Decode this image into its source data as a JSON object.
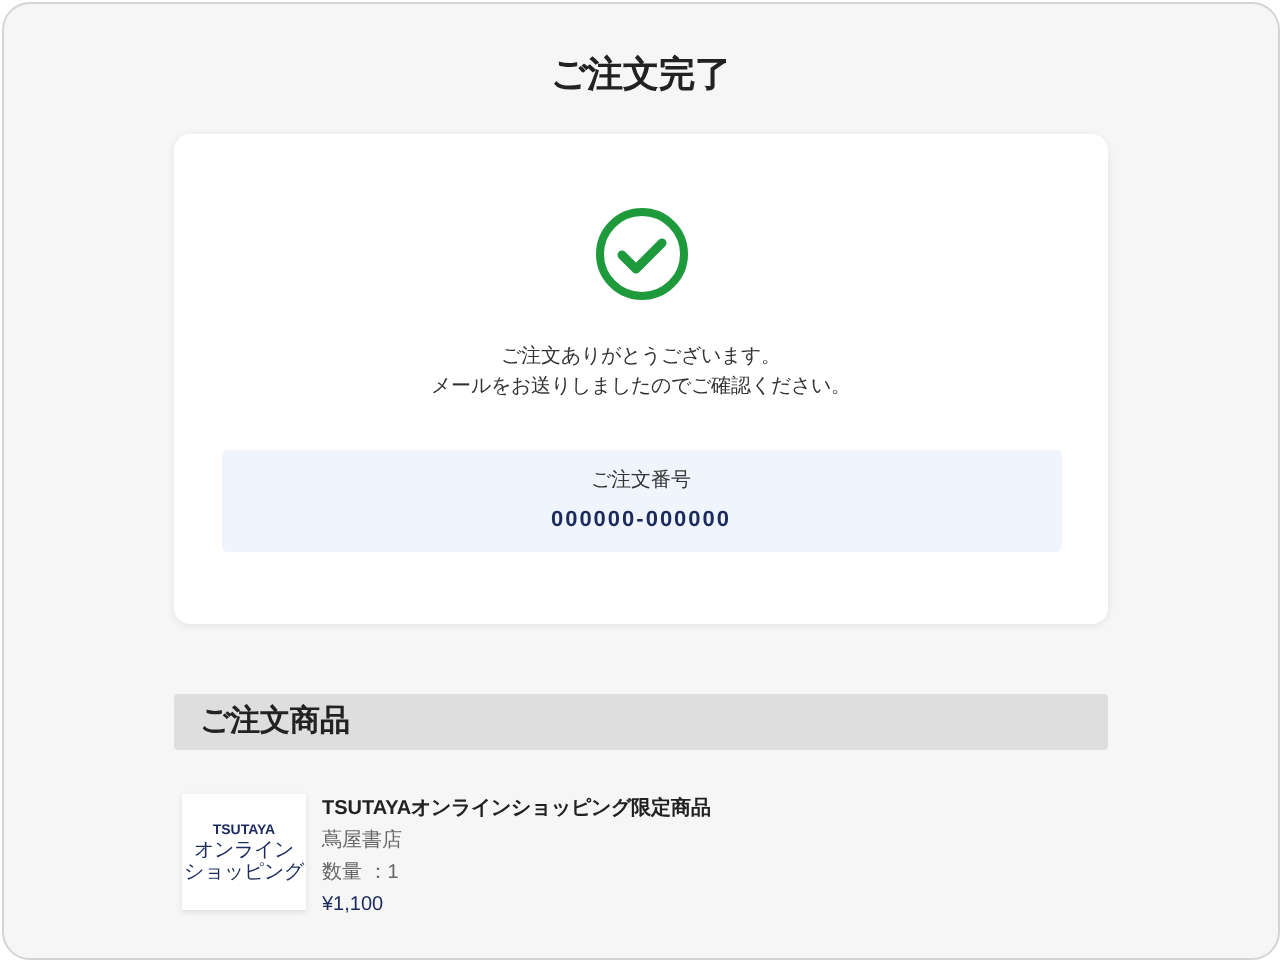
{
  "title": "ご注文完了",
  "confirmation": {
    "message_lines": [
      "ご注文ありがとうございます。",
      "メールをお送りしましたのでご確認ください。"
    ],
    "order_number_label": "ご注文番号",
    "order_number": "000000-000000"
  },
  "items_section": {
    "heading": "ご注文商品",
    "items": [
      {
        "thumbnail": {
          "brand": "TSUTAYA",
          "subtitle_lines": [
            "オンライン",
            "ショッピング"
          ]
        },
        "name": "TSUTAYAオンラインショッピング限定商品",
        "seller": "蔦屋書店",
        "quantity": "数量 ：1",
        "price": "¥1,100"
      }
    ]
  }
}
